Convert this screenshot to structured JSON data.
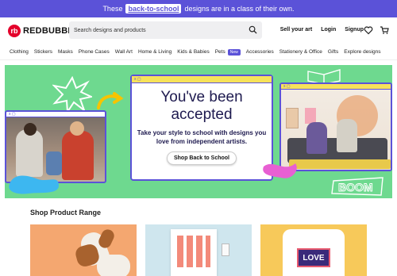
{
  "promo": {
    "pre": "These",
    "highlight": "back-to-school",
    "post": "designs are in a class of their own."
  },
  "header": {
    "logo_text": "REDBUBBLE",
    "logo_mark": "rb",
    "search_placeholder": "Search designs and products",
    "links": [
      "Sell your art",
      "Login",
      "Signup"
    ],
    "icons": [
      "search-icon",
      "heart-icon",
      "cart-icon"
    ]
  },
  "nav": {
    "items": [
      "Clothing",
      "Stickers",
      "Masks",
      "Phone Cases",
      "Wall Art",
      "Home & Living",
      "Kids & Babies",
      "Pets",
      "Accessories",
      "Stationery & Office",
      "Gifts",
      "Explore designs"
    ],
    "new_badge": "New"
  },
  "hero": {
    "heading": "You've been accepted",
    "body": "Take your style to school with designs you love from independent artists.",
    "cta": "Shop Back to School",
    "window_controls": "x ▢",
    "boom_text": "BOOM",
    "colors": {
      "bg": "#6ed98f",
      "accent": "#5b52d8",
      "yellow": "#f7e25a"
    }
  },
  "products": {
    "title": "Shop Product Range",
    "tshirt_text": "LOVE"
  }
}
